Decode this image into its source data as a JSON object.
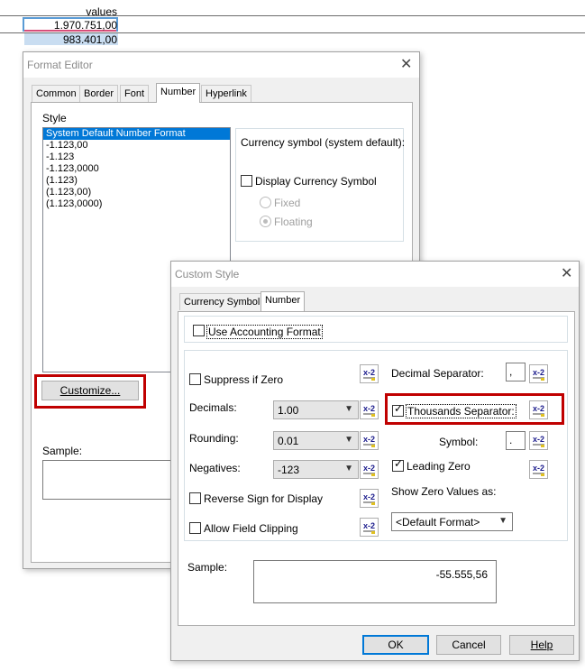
{
  "sheet": {
    "header": "values",
    "cells": [
      "1.970.751,00",
      "983.401,00"
    ]
  },
  "format_editor": {
    "title": "Format Editor",
    "tabs": [
      "Common",
      "Border",
      "Font",
      "Number",
      "Hyperlink"
    ],
    "active_tab": "Number",
    "style_label": "Style",
    "styles": [
      "System Default Number Format",
      "-1.123,00",
      "-1.123",
      "-1.123,0000",
      "(1.123)",
      "(1.123,00)",
      "(1.123,0000)"
    ],
    "selected_style": "System Default Number Format",
    "currency_label": "Currency symbol (system default):",
    "display_currency_label": "Display Currency Symbol",
    "fixed_label": "Fixed",
    "floating_label": "Floating",
    "customize_label": "Customize...",
    "sample_label": "Sample:"
  },
  "custom_style": {
    "title": "Custom Style",
    "tabs": [
      "Currency Symbol",
      "Number"
    ],
    "active_tab": "Number",
    "use_accounting": "Use Accounting Format",
    "suppress_zero": "Suppress if Zero",
    "decimals_label": "Decimals:",
    "decimals_value": "1.00",
    "rounding_label": "Rounding:",
    "rounding_value": "0.01",
    "negatives_label": "Negatives:",
    "negatives_value": "-123",
    "reverse_sign": "Reverse Sign for Display",
    "allow_clipping": "Allow Field Clipping",
    "decimal_sep_label": "Decimal Separator:",
    "decimal_sep_value": ",",
    "thousands_sep_label": "Thousands Separator:",
    "symbol_label": "Symbol:",
    "symbol_value": ".",
    "leading_zero": "Leading Zero",
    "show_zero_label": "Show Zero Values as:",
    "show_zero_value": "<Default Format>",
    "sample_label": "Sample:",
    "sample_value": "-55.555,56",
    "ok": "OK",
    "cancel": "Cancel",
    "help": "Help",
    "formula_icon_text": "x-2"
  },
  "highlight_color": "#c00000",
  "selection_color": "#0078d7"
}
